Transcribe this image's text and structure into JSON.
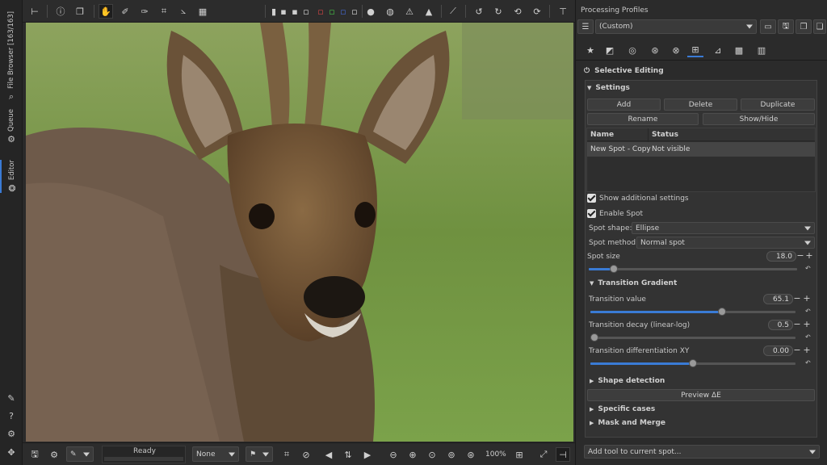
{
  "left_tabs": {
    "file_browser": "File Browser [163/163]",
    "queue": "Queue",
    "editor": "Editor"
  },
  "bottom_bar": {
    "status": "Ready",
    "progress_fraction": 0.0,
    "none_select": "None",
    "zoom": "100%"
  },
  "right_panel": {
    "title": "Processing Profiles",
    "profile_value": "(Custom)",
    "tool_title": "Selective Editing",
    "settings": {
      "header": "Settings",
      "buttons": {
        "add": "Add",
        "delete": "Delete",
        "duplicate": "Duplicate",
        "rename": "Rename",
        "show_hide": "Show/Hide"
      },
      "table": {
        "headers": [
          "Name",
          "Status"
        ],
        "rows": [
          {
            "name": "New Spot - Copy",
            "status": "Not visible"
          }
        ]
      },
      "show_additional": "Show additional settings",
      "enable_spot": "Enable Spot",
      "spot_shape_label": "Spot shape:",
      "spot_shape_value": "Ellipse",
      "spot_method_label": "Spot method:",
      "spot_method_value": "Normal spot",
      "spot_size": {
        "label": "Spot size",
        "value": "18.0",
        "fraction": 0.12
      }
    },
    "transition": {
      "header": "Transition Gradient",
      "value": {
        "label": "Transition value",
        "value": "65.1",
        "fraction": 0.643
      },
      "decay": {
        "label": "Transition decay (linear-log)",
        "value": "0.5",
        "fraction": 0.0
      },
      "diff": {
        "label": "Transition differentiation XY",
        "value": "0.00",
        "fraction": 0.5
      }
    },
    "shape_detection": "Shape detection",
    "preview_btn": "Preview ΔE",
    "specific_cases": "Specific cases",
    "mask_merge": "Mask and Merge",
    "add_tool": "Add tool to current spot..."
  },
  "icons": {
    "top_toolbar": [
      "history-panel-icon",
      "info-icon",
      "before-after-icon",
      "hand-tool-icon",
      "white-balance-picker-icon",
      "color-picker-icon",
      "crop-icon",
      "straighten-icon",
      "perspective-icon",
      "softproof-icon",
      "warning-icon",
      "clipped-icon",
      "histogram-icon",
      "rotate-left-icon",
      "rotate-right-icon",
      "flip-vertical-icon",
      "flip-horizontal-icon",
      "panel-toggle-icon"
    ],
    "profile_buttons": [
      "open-icon",
      "save-icon",
      "copy-icon",
      "paste-icon"
    ]
  },
  "colors": {
    "accent": "#3a7bd5",
    "panel_bg": "#2b2b2b",
    "highlight_row": "#454545"
  }
}
